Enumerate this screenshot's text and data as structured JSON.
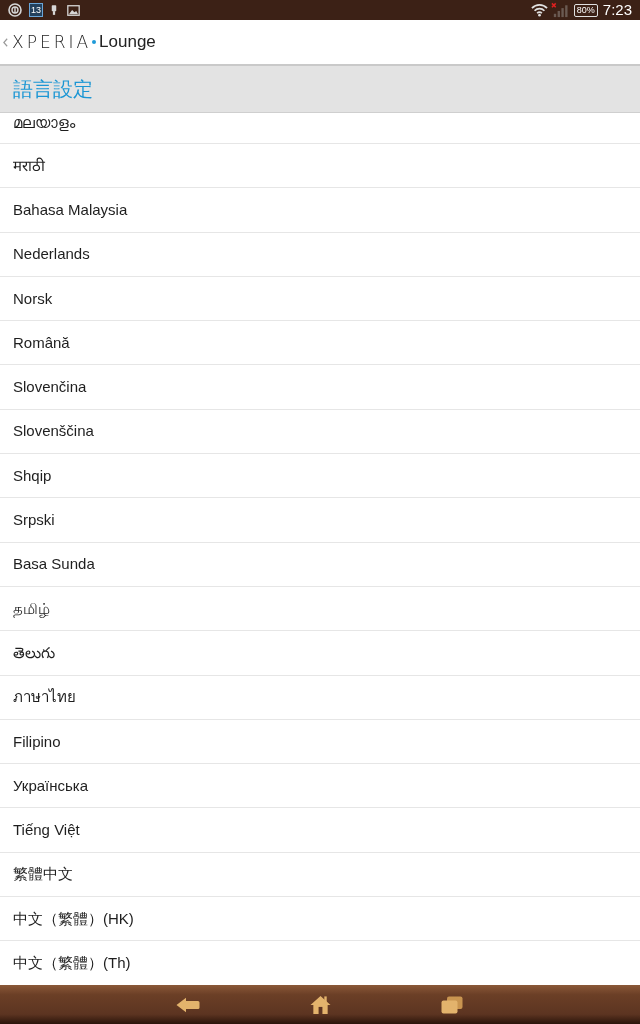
{
  "status_bar": {
    "calendar_day": "13",
    "battery": "80%",
    "time": "7:23"
  },
  "app_bar": {
    "brand": "XPERIA",
    "product": "Lounge"
  },
  "header": {
    "title": "語言設定"
  },
  "languages": [
    "മലയാളം",
    "मराठी",
    "Bahasa Malaysia",
    "Nederlands",
    "Norsk",
    "Română",
    "Slovenčina",
    "Slovenščina",
    "Shqip",
    "Srpski",
    "Basa Sunda",
    "தமிழ்",
    "తెలుగు",
    "ภาษาไทย",
    "Filipino",
    "Українська",
    "Tiếng Việt",
    "繁體中文",
    "中文（繁體）(HK)",
    "中文（繁體）(Th)"
  ]
}
